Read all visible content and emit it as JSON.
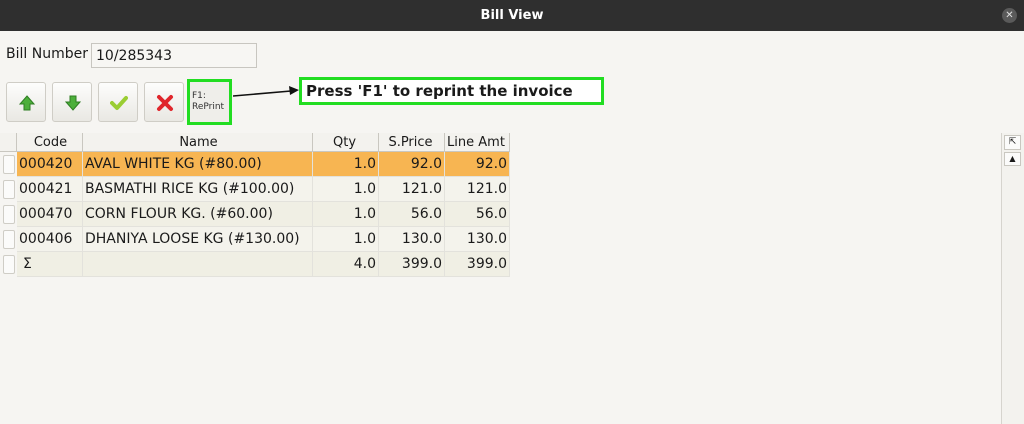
{
  "window": {
    "title": "Bill View"
  },
  "bill": {
    "label": "Bill Number",
    "value": "10/285343"
  },
  "toolbar": {
    "reprint_line1": "F1:",
    "reprint_line2": "RePrint"
  },
  "callout": {
    "text": "Press 'F1' to reprint the invoice"
  },
  "icons": {
    "up": "arrow-up-icon",
    "down": "arrow-down-icon",
    "ok": "checkmark-icon",
    "cancel": "cross-icon",
    "close": "close-icon"
  },
  "colors": {
    "highlight": "#22dd22",
    "selected_row": "#f7b552",
    "up_down_green": "#4caf3a",
    "check_green": "#9acd32",
    "cancel_red": "#e0262c"
  },
  "table": {
    "columns": [
      "Code",
      "Name",
      "Qty",
      "S.Price",
      "Line Amt"
    ],
    "rows": [
      {
        "code": "000420",
        "name": "AVAL WHITE  KG (#80.00)",
        "qty": "1.0",
        "price": "92.0",
        "amt": "92.0"
      },
      {
        "code": "000421",
        "name": "BASMATHI RICE KG (#100.00)",
        "qty": "1.0",
        "price": "121.0",
        "amt": "121.0"
      },
      {
        "code": "000470",
        "name": "CORN FLOUR KG. (#60.00)",
        "qty": "1.0",
        "price": "56.0",
        "amt": "56.0"
      },
      {
        "code": "000406",
        "name": "DHANIYA LOOSE KG (#130.00)",
        "qty": "1.0",
        "price": "130.0",
        "amt": "130.0"
      }
    ],
    "total": {
      "code": "Σ",
      "name": "",
      "qty": "4.0",
      "price": "399.0",
      "amt": "399.0"
    }
  },
  "scrollbar": {
    "corner_glyph": "⇱",
    "up_glyph": "▲"
  }
}
